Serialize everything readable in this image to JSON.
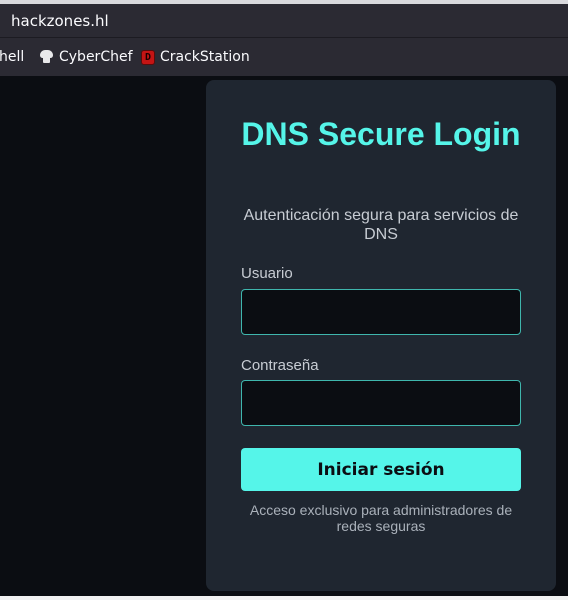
{
  "browser": {
    "address": "hackzones.hl",
    "bookmarks": [
      {
        "label": "hell",
        "icon": "none"
      },
      {
        "label": "CyberChef",
        "icon": "chef-hat-icon"
      },
      {
        "label": "CrackStation",
        "icon": "crackstation-icon",
        "icon_letter": "D"
      }
    ]
  },
  "login": {
    "title": "DNS Secure Login",
    "subtitle": "Autenticación segura para servicios de DNS",
    "username_label": "Usuario",
    "username_value": "",
    "password_label": "Contraseña",
    "password_value": "",
    "submit_label": "Iniciar sesión",
    "footer": "Acceso exclusivo para administradores de redes seguras"
  },
  "colors": {
    "accent": "#55f5e9",
    "card_background": "#1f2630",
    "page_background": "#0b0d12",
    "browser_chrome": "#2b2a33"
  }
}
